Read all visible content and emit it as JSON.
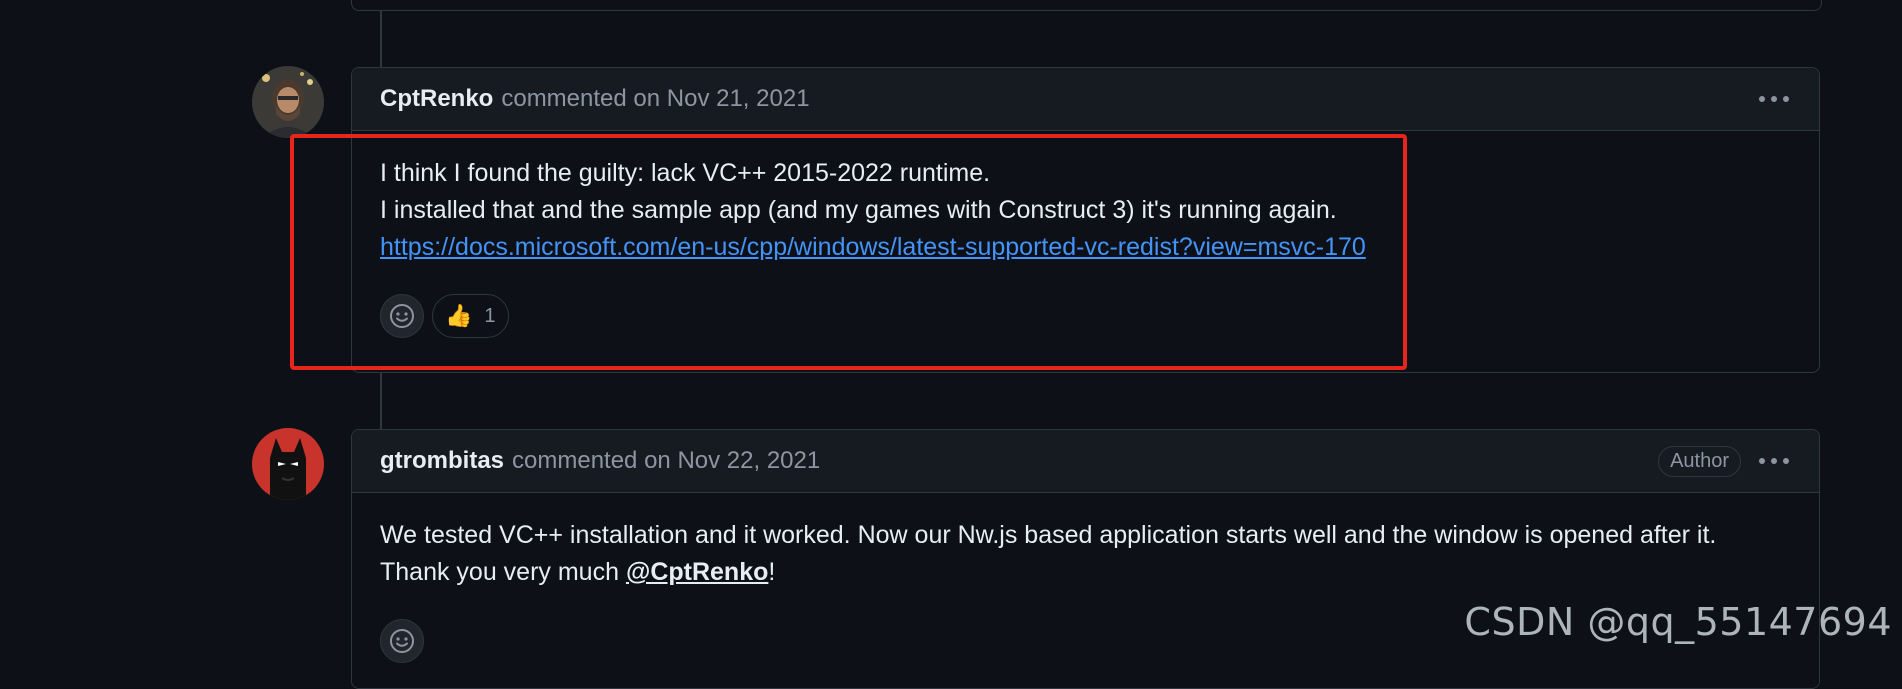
{
  "comments": [
    {
      "author": "CptRenko",
      "meta": "commented on Nov 21, 2021",
      "lines": [
        "I think I found the guilty: lack VC++ 2015-2022 runtime.",
        "I installed that and the sample app (and my games with Construct 3) it's running again."
      ],
      "link": "https://docs.microsoft.com/en-us/cpp/windows/latest-supported-vc-redist?view=msvc-170",
      "reaction_emoji": "👍",
      "reaction_count": "1"
    },
    {
      "author": "gtrombitas",
      "meta": "commented on Nov 22, 2021",
      "badge": "Author",
      "text_before": "We tested VC++ installation and it worked. Now our Nw.js based application starts well and the window is opened after it. Thank you very much ",
      "mention": "@CptRenko",
      "text_after": "!"
    }
  ],
  "watermark": "CSDN @qq_55147694",
  "icons": {
    "add_reaction": "smiley-icon",
    "more_options": "kebab-horizontal-icon"
  },
  "colors": {
    "background": "#0d1117",
    "link": "#4493f8",
    "highlight": "#e8251d"
  }
}
